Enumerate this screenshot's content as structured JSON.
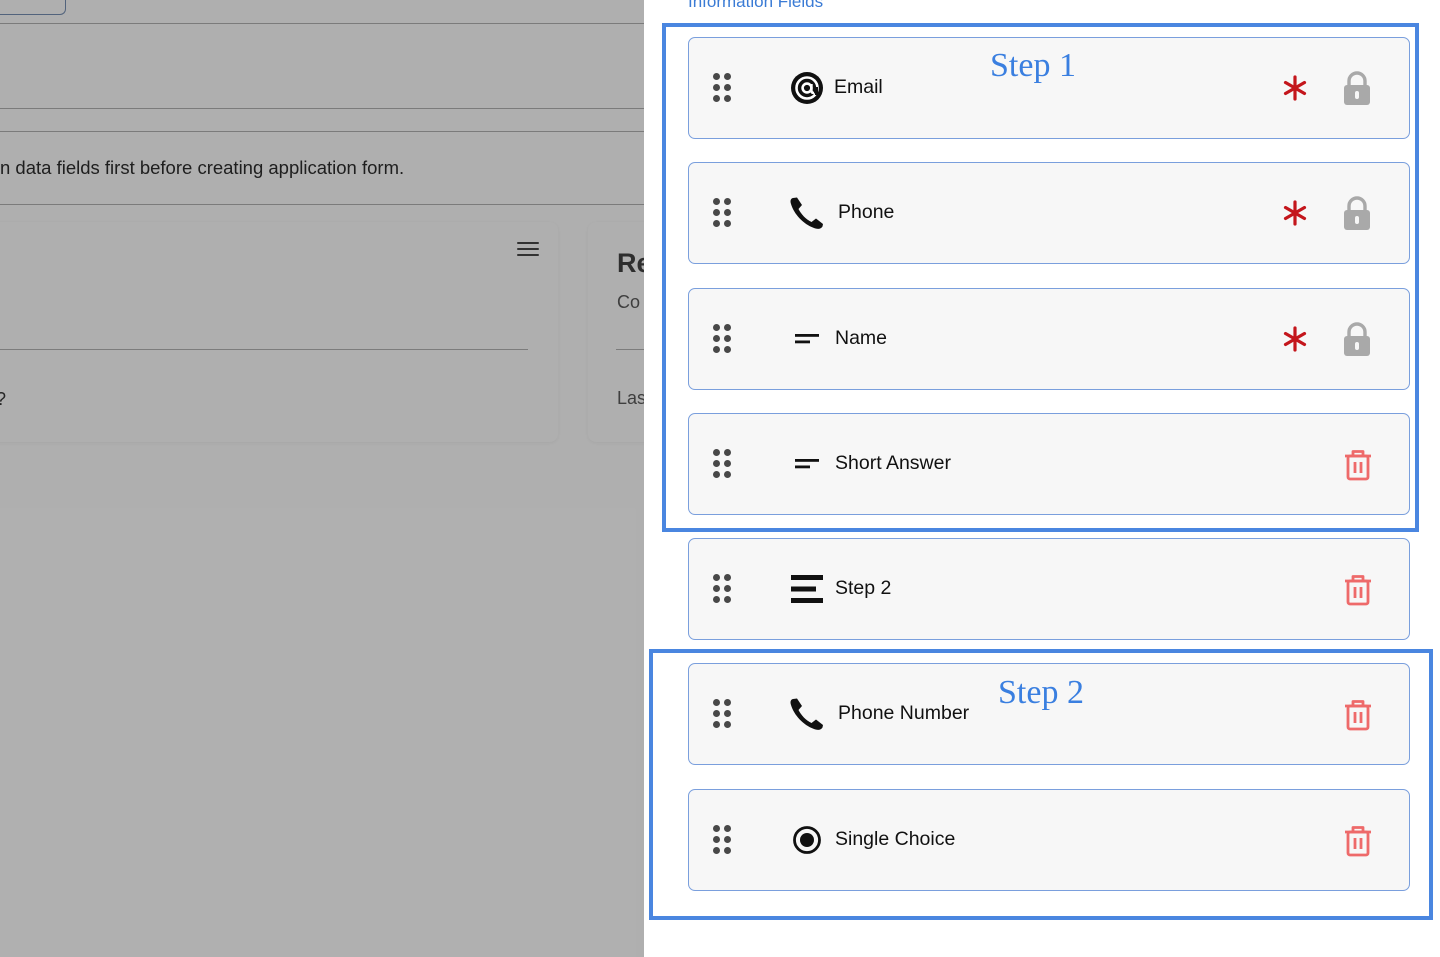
{
  "background": {
    "hint_text": "n data fields first before creating application form.",
    "card2_title": "Re",
    "card2_subtitle": "Co",
    "card2_last": "Las",
    "card1_fragment": "?"
  },
  "panel": {
    "title": "Information Fields",
    "fields": [
      {
        "label": "Email",
        "icon": "at-sign-icon",
        "required": true,
        "locked": true
      },
      {
        "label": "Phone",
        "icon": "phone-icon",
        "required": true,
        "locked": true
      },
      {
        "label": "Name",
        "icon": "short-text-icon",
        "required": true,
        "locked": true
      },
      {
        "label": "Short Answer",
        "icon": "short-text-icon",
        "required": false,
        "locked": false
      },
      {
        "label": "Step 2",
        "icon": "step-divider-icon",
        "required": false,
        "locked": false
      },
      {
        "label": "Phone Number",
        "icon": "phone-icon",
        "required": false,
        "locked": false
      },
      {
        "label": "Single Choice",
        "icon": "radio-icon",
        "required": false,
        "locked": false
      }
    ]
  },
  "annotations": {
    "step1_label": "Step 1",
    "step2_label": "Step 2"
  },
  "colors": {
    "annotation_blue": "#4a86e0",
    "required_red": "#c4161c",
    "trash_red": "#ee6a6a",
    "lock_gray": "#a9a9a9",
    "row_border": "#7a9fdd"
  }
}
